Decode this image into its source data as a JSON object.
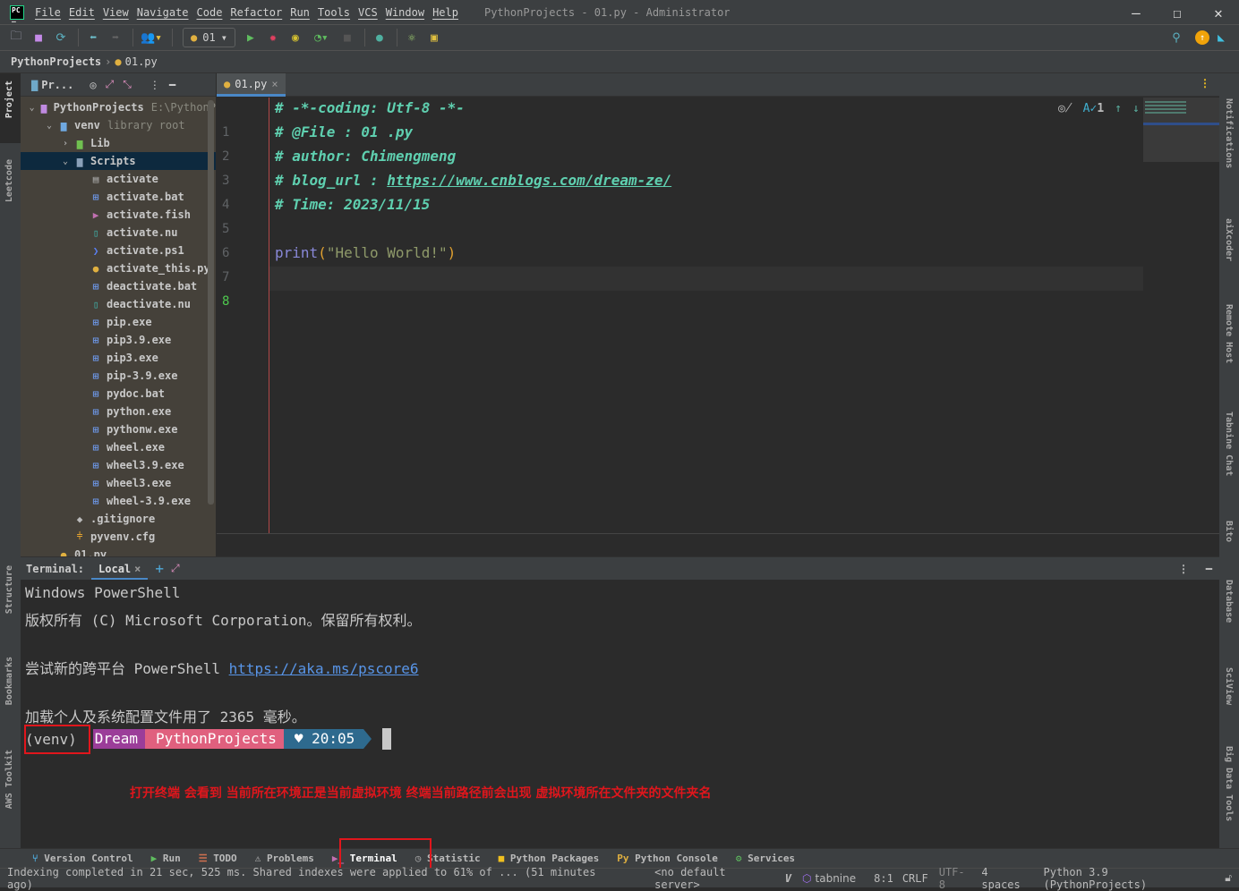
{
  "window": {
    "title": "PythonProjects - 01.py - Administrator",
    "logo": "PC"
  },
  "menu": [
    "File",
    "Edit",
    "View",
    "Navigate",
    "Code",
    "Refactor",
    "Run",
    "Tools",
    "VCS",
    "Window",
    "Help"
  ],
  "toolbar": {
    "run_config": "01"
  },
  "breadcrumb": {
    "project": "PythonProjects",
    "file": "01.py"
  },
  "left_stripe": [
    "Project",
    "Leetcode",
    "Structure",
    "Bookmarks",
    "AWS Toolkit"
  ],
  "right_stripe": [
    "Notifications",
    "aiXcoder",
    "Remote Host",
    "Tabnine Chat",
    "Bito",
    "Database",
    "SciView",
    "Big Data Tools"
  ],
  "project": {
    "header": "Pr...",
    "tree": [
      {
        "label": "PythonProjects",
        "hint": "E:\\PythonP",
        "level": 0,
        "chev": "v",
        "icon": "folder-icon"
      },
      {
        "label": "venv",
        "hint": "library root",
        "level": 1,
        "chev": "v",
        "icon": "folder-icon"
      },
      {
        "label": "Lib",
        "level": 2,
        "chev": ">",
        "icon": "folder-icon"
      },
      {
        "label": "Scripts",
        "level": 2,
        "chev": "v",
        "icon": "folder-icon",
        "selected": true
      },
      {
        "label": "activate",
        "level": 3,
        "icon": "text-file-icon"
      },
      {
        "label": "activate.bat",
        "level": 3,
        "icon": "windows-icon"
      },
      {
        "label": "activate.fish",
        "level": 3,
        "icon": "shell-icon"
      },
      {
        "label": "activate.nu",
        "level": 3,
        "icon": "nu-icon"
      },
      {
        "label": "activate.ps1",
        "level": 3,
        "icon": "powershell-icon"
      },
      {
        "label": "activate_this.py",
        "level": 3,
        "icon": "python-icon"
      },
      {
        "label": "deactivate.bat",
        "level": 3,
        "icon": "windows-icon"
      },
      {
        "label": "deactivate.nu",
        "level": 3,
        "icon": "nu-icon"
      },
      {
        "label": "pip.exe",
        "level": 3,
        "icon": "windows-icon"
      },
      {
        "label": "pip3.9.exe",
        "level": 3,
        "icon": "windows-icon"
      },
      {
        "label": "pip3.exe",
        "level": 3,
        "icon": "windows-icon"
      },
      {
        "label": "pip-3.9.exe",
        "level": 3,
        "icon": "windows-icon"
      },
      {
        "label": "pydoc.bat",
        "level": 3,
        "icon": "windows-icon"
      },
      {
        "label": "python.exe",
        "level": 3,
        "icon": "windows-icon"
      },
      {
        "label": "pythonw.exe",
        "level": 3,
        "icon": "windows-icon"
      },
      {
        "label": "wheel.exe",
        "level": 3,
        "icon": "windows-icon"
      },
      {
        "label": "wheel3.9.exe",
        "level": 3,
        "icon": "windows-icon"
      },
      {
        "label": "wheel3.exe",
        "level": 3,
        "icon": "windows-icon"
      },
      {
        "label": "wheel-3.9.exe",
        "level": 3,
        "icon": "windows-icon"
      },
      {
        "label": ".gitignore",
        "level": 2,
        "icon": "git-icon"
      },
      {
        "label": "pyvenv.cfg",
        "level": 2,
        "icon": "config-icon"
      },
      {
        "label": "01.py",
        "level": 1,
        "icon": "python-icon"
      }
    ]
  },
  "editor": {
    "tab": "01.py",
    "inspection_count": "1",
    "lines": [
      "# -*-coding: Utf-8 -*-",
      "# @File : 01 .py",
      "# author: Chimengmeng",
      "# blog_url : https://www.cnblogs.com/dream-ze/",
      "# Time: 2023/11/15",
      "",
      "print(\"Hello World!\")",
      ""
    ],
    "print_parts": {
      "fn": "print",
      "open": "(",
      "str": "\"Hello World!\"",
      "close": ")"
    }
  },
  "terminal": {
    "label": "Terminal:",
    "tab": "Local",
    "lines": [
      "Windows PowerShell",
      "版权所有 (C) Microsoft Corporation。保留所有权利。",
      "",
      "尝试新的跨平台 PowerShell ",
      "",
      "加载个人及系统配置文件用了 2365 毫秒。"
    ],
    "link": "https://aka.ms/pscore6",
    "prompt": {
      "venv": "(venv)",
      "user": "Dream",
      "path": "PythonProjects",
      "time": "♥ 20:05"
    },
    "annotation": "打开终端 会看到 当前所在环境正是当前虚拟环境 终端当前路径前会出现 虚拟环境所在文件夹的文件夹名"
  },
  "bottom_tools": [
    "Version Control",
    "Run",
    "TODO",
    "Problems",
    "Terminal",
    "Statistic",
    "Python Packages",
    "Python Console",
    "Services"
  ],
  "status": {
    "message": "Indexing completed in 21 sec, 525 ms. Shared indexes were applied to 61% of ... (51 minutes ago)",
    "server": "<no default server>",
    "tabnine": "tabnine",
    "position": "8:1",
    "line_sep": "CRLF",
    "encoding": "UTF-8",
    "indent": "4 spaces",
    "interpreter": "Python 3.9 (PythonProjects)"
  },
  "colors": {
    "comment": "#5fd0b0",
    "annotation": "#e0161c",
    "prompt_user": "#9b3d99",
    "prompt_path": "#e0607e",
    "prompt_time": "#2e6a8e",
    "selection": "#0d293e"
  }
}
